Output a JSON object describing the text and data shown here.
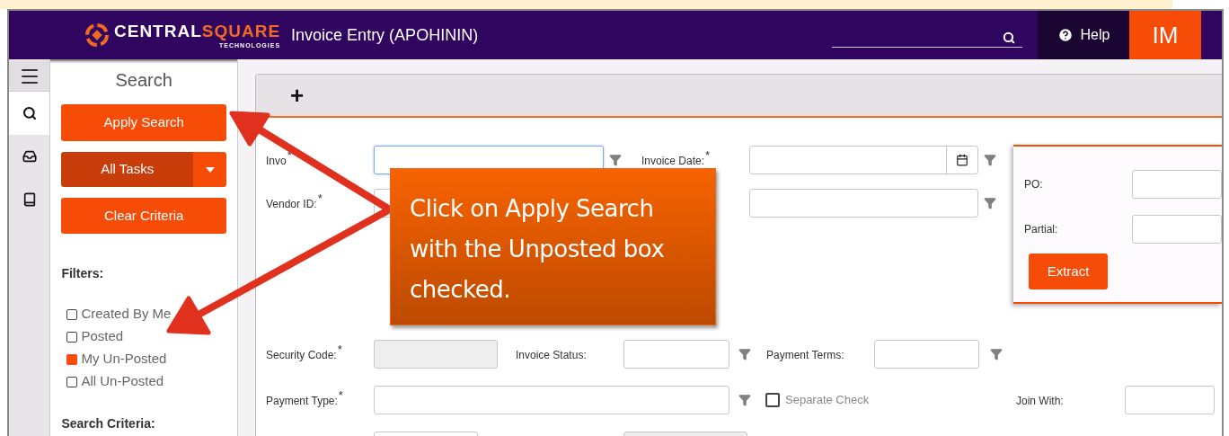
{
  "header": {
    "logo_main": "CENTRAL",
    "logo_accent": "SQUARE",
    "logo_sub": "TECHNOLOGIES",
    "title": "Invoice Entry (APOHININ)",
    "help": "Help",
    "user_initials": "IM"
  },
  "rail": [
    {
      "kind": "search",
      "selected": true
    },
    {
      "kind": "inbox",
      "selected": false
    },
    {
      "kind": "book",
      "selected": false
    }
  ],
  "sidebar": {
    "title": "Search",
    "apply_button": "Apply Search",
    "tasks_button": "All Tasks",
    "clear_button": "Clear Criteria",
    "filters_heading": "Filters:",
    "filters": [
      {
        "label": "Created By Me",
        "checked": false
      },
      {
        "label": "Posted",
        "checked": false
      },
      {
        "label": "My Un-Posted",
        "checked": true
      },
      {
        "label": "All Un-Posted",
        "checked": false
      }
    ],
    "criteria_heading": "Search Criteria:"
  },
  "toolbar": {
    "add": "+"
  },
  "form": {
    "invoice": {
      "label": "Invo",
      "required_mark": "*",
      "focused": true
    },
    "invoice_date": {
      "label": "Invoice Date:",
      "required_mark": "*"
    },
    "vendor_id": {
      "label": "Vendor ID:",
      "required_mark": "*"
    },
    "security_code": {
      "label": "Security Code:",
      "required_mark": "*",
      "disabled": true
    },
    "invoice_status": {
      "label": "Invoice Status:"
    },
    "payment_terms": {
      "label": "Payment Terms:"
    },
    "payment_type": {
      "label": "Payment Type:",
      "required_mark": "*"
    },
    "separate_check": {
      "label": "Separate Check",
      "checked": false
    },
    "join_with": {
      "label": "Join With:"
    }
  },
  "extract_panel": {
    "po_label": "PO:",
    "partial_label": "Partial:",
    "button": "Extract"
  },
  "callout": {
    "text": "Click on Apply Search with the Unposted box checked."
  }
}
